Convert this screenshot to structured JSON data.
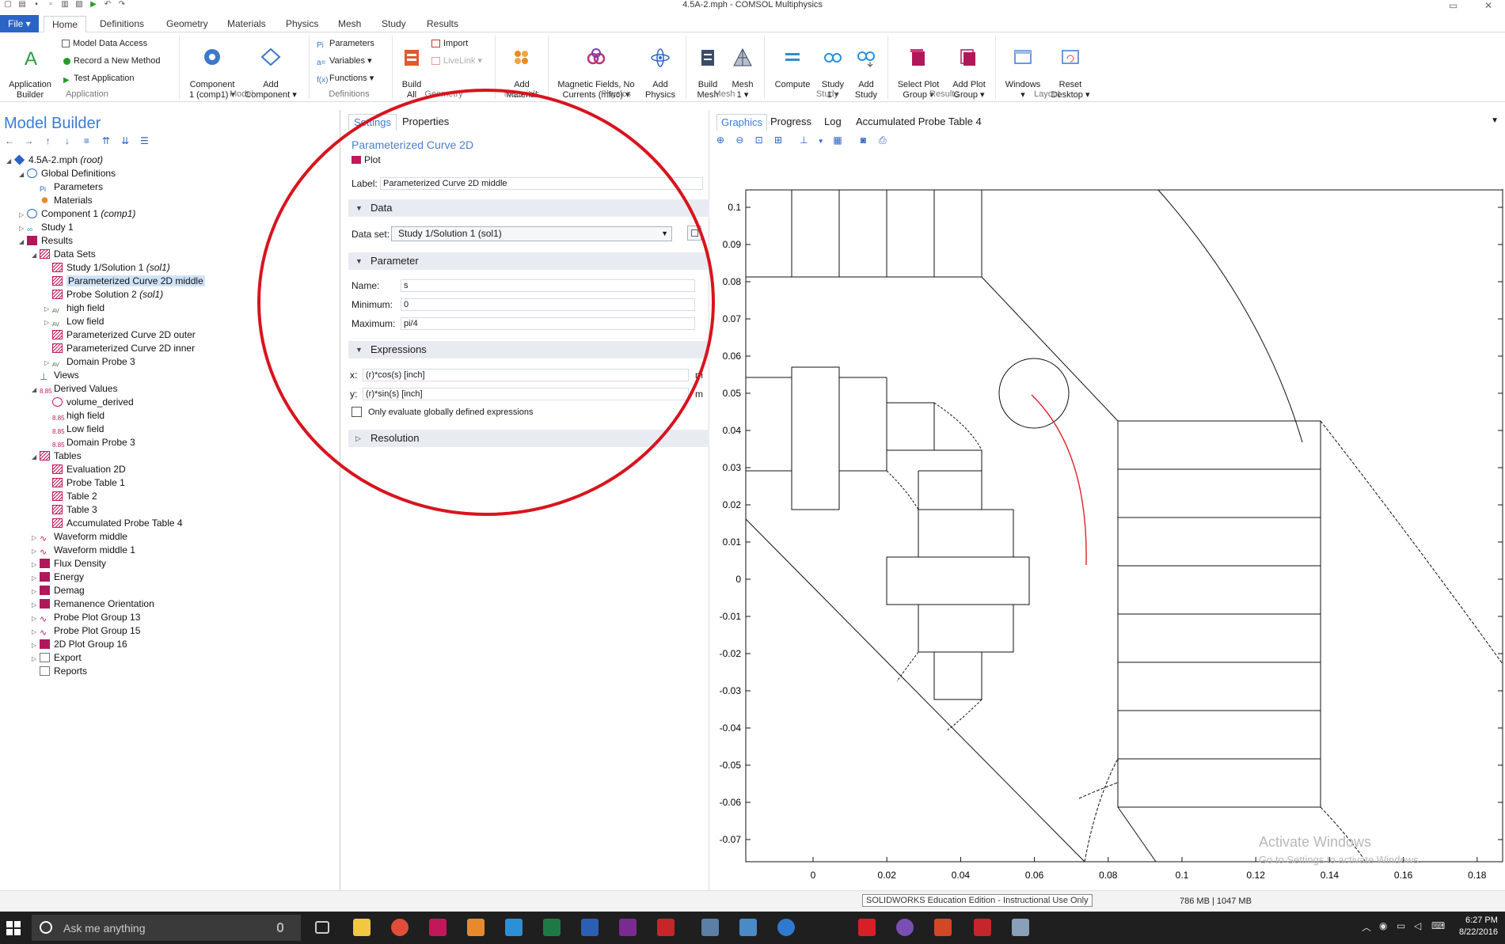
{
  "window": {
    "title": "4.5A-2.mph - COMSOL Multiphysics"
  },
  "ribbon_tabs": {
    "file": "File ▾",
    "items": [
      "Home",
      "Definitions",
      "Geometry",
      "Materials",
      "Physics",
      "Mesh",
      "Study",
      "Results"
    ],
    "active": "Home"
  },
  "ribbon": {
    "application_builder": "Application\nBuilder",
    "model_data_access": "Model Data Access",
    "record_method": "Record a New Method",
    "test_application": "Test Application",
    "component": "Component\n1 (comp1) ▾",
    "add_component": "Add\nComponent ▾",
    "parameters": "Parameters",
    "variables": "Variables ▾",
    "functions": "Functions ▾",
    "build_all": "Build\nAll",
    "import": "Import",
    "livelink": "LiveLink ▾",
    "add_material": "Add\nMaterial",
    "magnetic_fields": "Magnetic Fields, No\nCurrents (mfnc) ▾",
    "add_physics": "Add\nPhysics",
    "build_mesh": "Build\nMesh",
    "mesh1": "Mesh\n1 ▾",
    "compute": "Compute",
    "study1": "Study\n1 ▾",
    "add_study": "Add\nStudy",
    "select_plot_group": "Select Plot\nGroup ▾",
    "add_plot_group": "Add Plot\nGroup ▾",
    "windows": "Windows\n▾",
    "reset_desktop": "Reset\nDesktop ▾",
    "groups": [
      "Application",
      "Model",
      "Definitions",
      "Geometry",
      "Materials",
      "Physics",
      "Mesh",
      "Study",
      "Results",
      "Layout"
    ]
  },
  "model_builder": {
    "title": "Model Builder",
    "tree": [
      {
        "label": "4.5A-2.mph",
        "italic": " (root)",
        "level": 0,
        "icon": "root-icon",
        "expander": "◢"
      },
      {
        "label": "Global Definitions",
        "level": 1,
        "icon": "globe-icon",
        "expander": "◢"
      },
      {
        "label": "Parameters",
        "level": 2,
        "icon": "parameters-icon",
        "expander": ""
      },
      {
        "label": "Materials",
        "level": 2,
        "icon": "materials-icon",
        "expander": ""
      },
      {
        "label": "Component 1",
        "italic": " (comp1)",
        "level": 1,
        "icon": "component-icon",
        "expander": "▷"
      },
      {
        "label": "Study 1",
        "level": 1,
        "icon": "study-icon",
        "expander": "▷"
      },
      {
        "label": "Results",
        "level": 1,
        "icon": "results-icon",
        "expander": "◢"
      },
      {
        "label": "Data Sets",
        "level": 2,
        "icon": "datasets-icon",
        "expander": "◢"
      },
      {
        "label": "Study 1/Solution 1",
        "italic": " (sol1)",
        "level": 3,
        "icon": "solution-icon",
        "expander": ""
      },
      {
        "label": "Parameterized Curve 2D  middle",
        "level": 3,
        "icon": "curve-icon",
        "expander": "",
        "selected": true
      },
      {
        "label": "Probe Solution 2",
        "italic": " (sol1)",
        "level": 3,
        "icon": "solution-icon",
        "expander": ""
      },
      {
        "label": "high field",
        "level": 3,
        "icon": "probe-icon",
        "expander": "▷"
      },
      {
        "label": "Low field",
        "level": 3,
        "icon": "probe-icon",
        "expander": "▷"
      },
      {
        "label": "Parameterized Curve 2D outer",
        "level": 3,
        "icon": "curve-icon",
        "expander": ""
      },
      {
        "label": "Parameterized Curve 2D inner",
        "level": 3,
        "icon": "curve-icon",
        "expander": ""
      },
      {
        "label": "Domain Probe 3",
        "level": 3,
        "icon": "probe-icon",
        "expander": "▷"
      },
      {
        "label": "Views",
        "level": 2,
        "icon": "views-icon",
        "expander": ""
      },
      {
        "label": "Derived Values",
        "level": 2,
        "icon": "derived-icon",
        "expander": "◢"
      },
      {
        "label": "volume_derived",
        "level": 3,
        "icon": "value-icon",
        "expander": ""
      },
      {
        "label": "high field",
        "level": 3,
        "icon": "derived-icon",
        "expander": ""
      },
      {
        "label": "Low field",
        "level": 3,
        "icon": "derived-icon",
        "expander": ""
      },
      {
        "label": "Domain Probe 3",
        "level": 3,
        "icon": "derived-icon",
        "expander": ""
      },
      {
        "label": "Tables",
        "level": 2,
        "icon": "tables-icon",
        "expander": "◢"
      },
      {
        "label": "Evaluation 2D",
        "level": 3,
        "icon": "table-icon",
        "expander": ""
      },
      {
        "label": "Probe Table 1",
        "level": 3,
        "icon": "table-icon",
        "expander": ""
      },
      {
        "label": "Table 2",
        "level": 3,
        "icon": "table-icon",
        "expander": ""
      },
      {
        "label": "Table 3",
        "level": 3,
        "icon": "table-icon",
        "expander": ""
      },
      {
        "label": "Accumulated Probe Table 4",
        "level": 3,
        "icon": "table-icon",
        "expander": ""
      },
      {
        "label": "Waveform middle",
        "level": 2,
        "icon": "waveform-icon",
        "expander": "▷"
      },
      {
        "label": "Waveform middle 1",
        "level": 2,
        "icon": "waveform-icon",
        "expander": "▷"
      },
      {
        "label": "Flux Density",
        "level": 2,
        "icon": "plot-icon",
        "expander": "▷"
      },
      {
        "label": "Energy",
        "level": 2,
        "icon": "plot-icon",
        "expander": "▷"
      },
      {
        "label": "Demag",
        "level": 2,
        "icon": "plot-icon",
        "expander": "▷"
      },
      {
        "label": "Remanence Orientation",
        "level": 2,
        "icon": "plot-icon",
        "expander": "▷"
      },
      {
        "label": "Probe Plot Group 13",
        "level": 2,
        "icon": "waveform-icon",
        "expander": "▷"
      },
      {
        "label": "Probe Plot Group 15",
        "level": 2,
        "icon": "waveform-icon",
        "expander": "▷"
      },
      {
        "label": "2D Plot Group 16",
        "level": 2,
        "icon": "plot-icon",
        "expander": "▷"
      },
      {
        "label": "Export",
        "level": 2,
        "icon": "export-icon",
        "expander": "▷"
      },
      {
        "label": "Reports",
        "level": 2,
        "icon": "reports-icon",
        "expander": ""
      }
    ]
  },
  "settings": {
    "tab_settings": "Settings",
    "tab_properties": "Properties",
    "title": "Parameterized Curve 2D",
    "subtitle": "Plot",
    "label_label": "Label:",
    "label_value": "Parameterized Curve 2D  middle",
    "section_data": "Data",
    "dataset_label": "Data set:",
    "dataset_value": "Study 1/Solution 1 (sol1)",
    "section_parameter": "Parameter",
    "name_label": "Name:",
    "name_value": "s",
    "min_label": "Minimum:",
    "min_value": "0",
    "max_label": "Maximum:",
    "max_value": "pi/4",
    "section_expressions": "Expressions",
    "x_label": "x:",
    "x_value": "(r)*cos(s) [inch]",
    "x_unit": "m",
    "y_label": "y:",
    "y_value": "(r)*sin(s) [inch]",
    "y_unit": "m",
    "only_global_label": "Only evaluate globally defined expressions",
    "section_resolution": "Resolution"
  },
  "graphics": {
    "tabs": [
      "Graphics",
      "Progress",
      "Log",
      "Accumulated Probe Table 4"
    ],
    "active": "Graphics",
    "x_ticks": [
      "0",
      "0.02",
      "0.04",
      "0.06",
      "0.08",
      "0.1",
      "0.12",
      "0.14",
      "0.16",
      "0.18"
    ],
    "y_ticks": [
      "0.1",
      "0.09",
      "0.08",
      "0.07",
      "0.06",
      "0.05",
      "0.04",
      "0.03",
      "0.02",
      "0.01",
      "0",
      "-0.01",
      "-0.02",
      "-0.03",
      "-0.04",
      "-0.05",
      "-0.06",
      "-0.07"
    ],
    "watermark_title": "Activate Windows",
    "watermark_sub": "Go to Settings to activate Windows.",
    "colors": {
      "curve": "#e0202a",
      "geometry": "#111111"
    }
  },
  "status": {
    "solidworks_note": "SOLIDWORKS Education Edition - Instructional Use Only",
    "memory": "786 MB | 1047 MB"
  },
  "taskbar": {
    "search_placeholder": "Ask me anything",
    "time": "6:27 PM",
    "date": "8/22/2016"
  },
  "annotation": {
    "color": "#d8141e"
  }
}
